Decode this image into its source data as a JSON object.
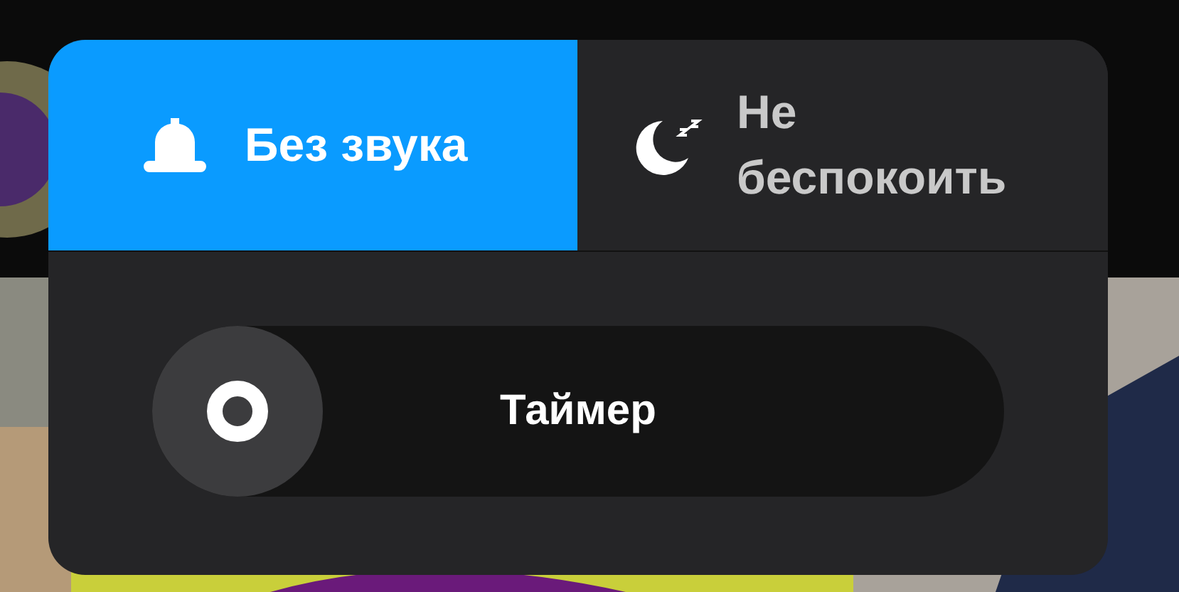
{
  "tabs": [
    {
      "label": "Без звука",
      "selected": true,
      "kind": "bell"
    },
    {
      "label": "Не беспокоить",
      "selected": false,
      "kind": "moon"
    }
  ],
  "timer": {
    "label": "Таймер",
    "level": 0
  }
}
